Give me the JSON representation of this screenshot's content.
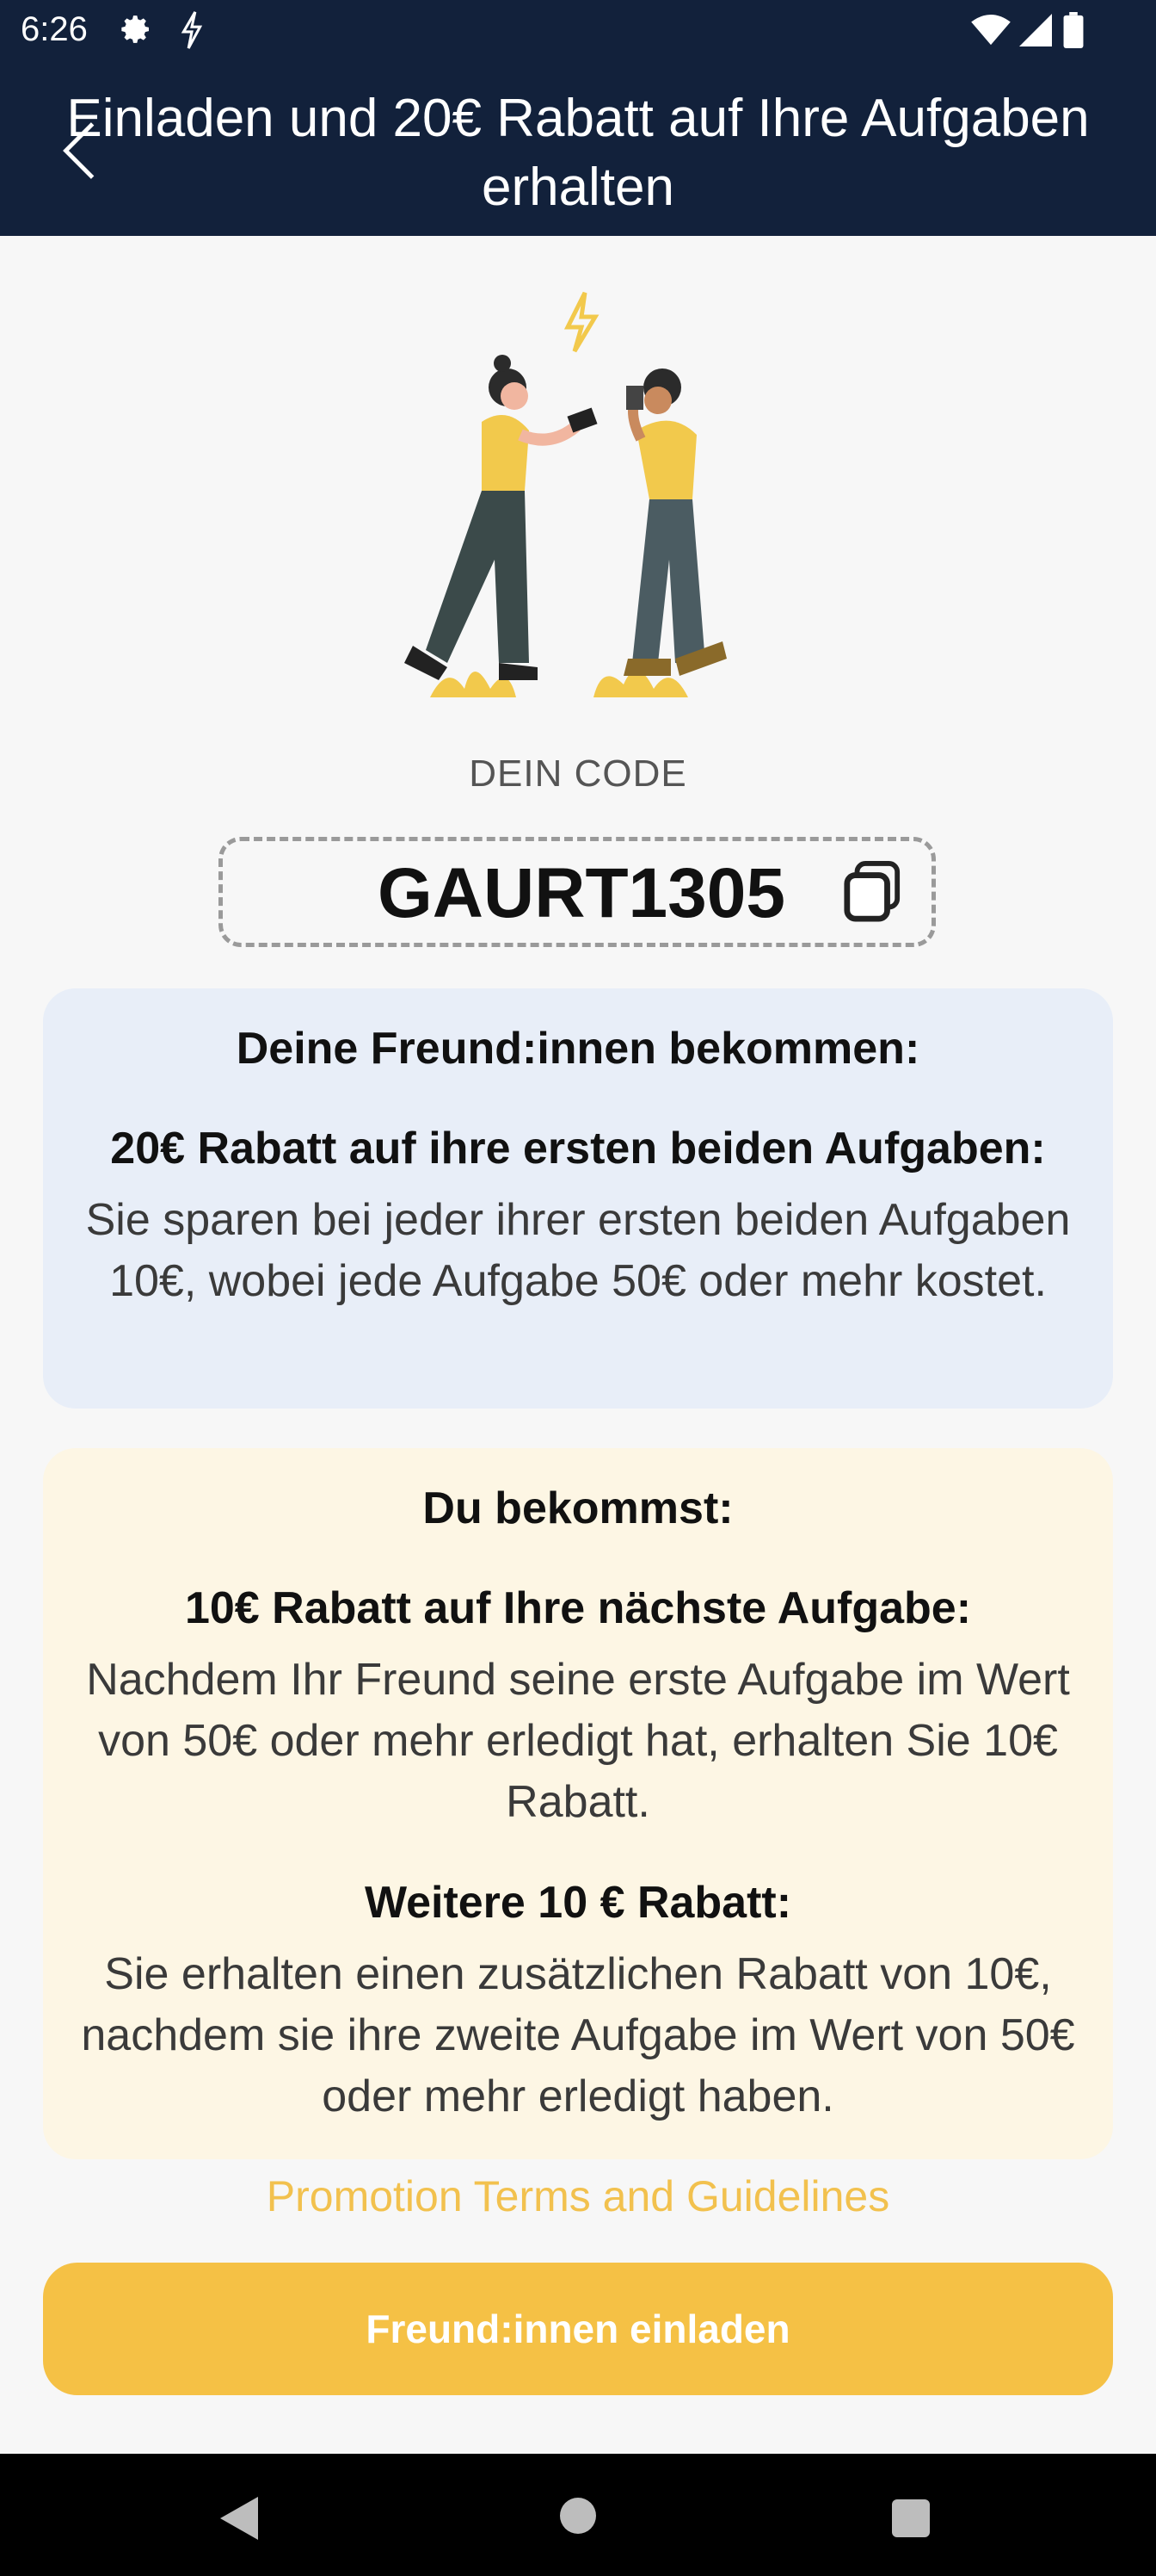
{
  "status_bar": {
    "time": "6:26",
    "icons": [
      "gear-icon",
      "bolt-icon",
      "wifi-icon",
      "signal-icon",
      "battery-icon"
    ]
  },
  "header": {
    "title": "Einladen und 20€ Rabatt auf Ihre Aufgaben erhalten",
    "back_icon": "chevron-left-icon"
  },
  "code_section": {
    "label": "DEIN CODE",
    "code": "GAURT1305",
    "copy_icon": "copy-icon"
  },
  "friends_card": {
    "title": "Deine Freund:innen bekommen:",
    "subtitle": "20€ Rabatt auf ihre ersten beiden Aufgaben:",
    "text": "Sie sparen bei jeder ihrer ersten beiden Aufgaben 10€, wobei jede Aufgabe 50€ oder mehr kostet."
  },
  "you_card": {
    "title": "Du bekommst:",
    "subtitle1": "10€ Rabatt auf Ihre nächste Aufgabe:",
    "text1": "Nachdem Ihr Freund seine erste Aufgabe im Wert von 50€ oder mehr erledigt hat, erhalten Sie 10€ Rabatt.",
    "subtitle2": "Weitere 10 € Rabatt:",
    "text2": "Sie erhalten einen zusätzlichen Rabatt von 10€, nachdem sie ihre zweite Aufgabe im Wert von 50€ oder mehr erledigt haben."
  },
  "promo_link": "Promotion Terms and Guidelines",
  "invite_button": "Freund:innen einladen",
  "colors": {
    "header_bg": "#12213b",
    "accent_yellow": "#f5c145",
    "blue_card": "#e8eef8",
    "yellow_card": "#fdf6e4"
  },
  "nav_bar": {
    "icons": [
      "back-triangle-icon",
      "home-circle-icon",
      "recent-square-icon"
    ]
  }
}
